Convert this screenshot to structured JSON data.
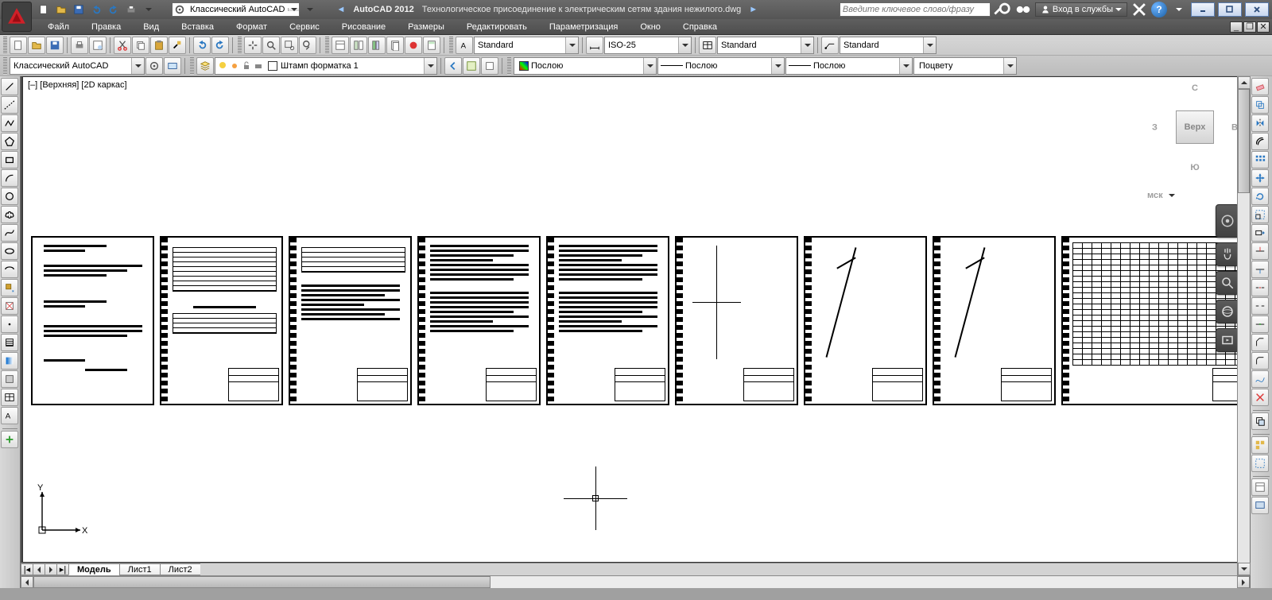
{
  "title": {
    "app": "AutoCAD 2012",
    "doc": "Технологическое присоединение к электрическим сетям здания нежилого.dwg"
  },
  "qat_workspace": "Классический AutoCAD",
  "search_placeholder": "Введите ключевое слово/фразу",
  "sign_in": "Вход в службы",
  "menu": [
    "Файл",
    "Правка",
    "Вид",
    "Вставка",
    "Формат",
    "Сервис",
    "Рисование",
    "Размеры",
    "Редактировать",
    "Параметризация",
    "Окно",
    "Справка"
  ],
  "row1": {
    "combo_textstyle": "Standard",
    "combo_dimstyle": "ISO-25",
    "combo_tablestyle": "Standard",
    "combo_mleaderstyle": "Standard"
  },
  "row2": {
    "workspace_combo": "Классический AutoCAD",
    "layer_combo": "Штамп форматка 1",
    "prop_color": "Послою",
    "prop_linetype": "Послою",
    "prop_lineweight": "Послою",
    "prop_plotstyle": "Поцвету"
  },
  "viewport_label": "[–] [Верхняя] [2D каркас]",
  "viewcube": {
    "top": "Верх",
    "n": "С",
    "s": "Ю",
    "e": "В",
    "w": "З",
    "wcs": "мск"
  },
  "ucs": {
    "x": "X",
    "y": "Y"
  },
  "layout_tabs": {
    "model": "Модель",
    "tabs": [
      "Лист1",
      "Лист2"
    ]
  }
}
